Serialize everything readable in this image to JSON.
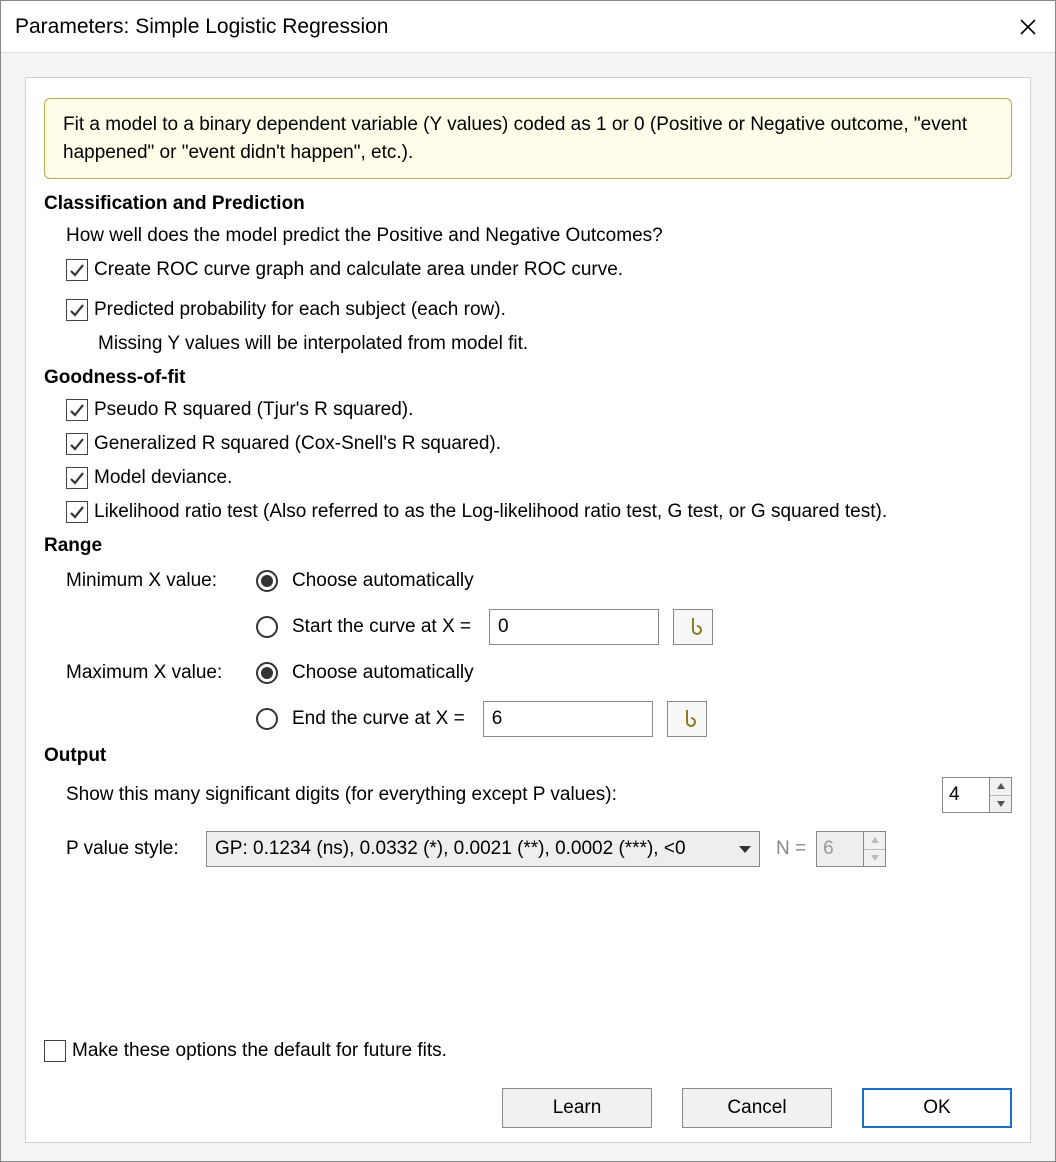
{
  "window": {
    "title": "Parameters: Simple Logistic Regression"
  },
  "info": {
    "text": "Fit a model to a binary dependent variable (Y values) coded as 1 or 0 (Positive or Negative outcome, \"event happened\" or \"event didn't happen\", etc.)."
  },
  "sections": {
    "classification": {
      "header": "Classification and Prediction",
      "intro": "How well does the model predict the Positive and Negative Outcomes?",
      "roc": {
        "label": "Create ROC curve graph and calculate area under ROC curve.",
        "checked": true
      },
      "predicted": {
        "label": "Predicted probability for each subject (each row).",
        "sub": "Missing Y values will be interpolated from model fit.",
        "checked": true
      }
    },
    "goodness": {
      "header": "Goodness-of-fit",
      "pseudo": {
        "label": "Pseudo R squared (Tjur's R squared).",
        "checked": true
      },
      "cox": {
        "label": "Generalized R squared (Cox-Snell's R squared).",
        "checked": true
      },
      "deviance": {
        "label": "Model deviance.",
        "checked": true
      },
      "lrt": {
        "label": "Likelihood ratio test (Also referred to as the Log-likelihood ratio test, G test, or G squared test).",
        "checked": true
      }
    },
    "range": {
      "header": "Range",
      "min": {
        "label": "Minimum X value:",
        "auto_label": "Choose automatically",
        "manual_label": "Start the curve at X =",
        "value": "0",
        "selected": "auto"
      },
      "max": {
        "label": "Maximum X value:",
        "auto_label": "Choose automatically",
        "manual_label": "End the curve at X =",
        "value": "6",
        "selected": "auto"
      }
    },
    "output": {
      "header": "Output",
      "digits_label": "Show this many significant digits (for everything except P values):",
      "digits_value": "4",
      "pstyle_label": "P value style:",
      "pstyle_value": "GP: 0.1234 (ns), 0.0332 (*), 0.0021 (**), 0.0002 (***), <0",
      "n_label": "N =",
      "n_value": "6"
    }
  },
  "footer": {
    "default_label": "Make these options the default for future fits.",
    "default_checked": false,
    "learn": "Learn",
    "cancel": "Cancel",
    "ok": "OK"
  }
}
